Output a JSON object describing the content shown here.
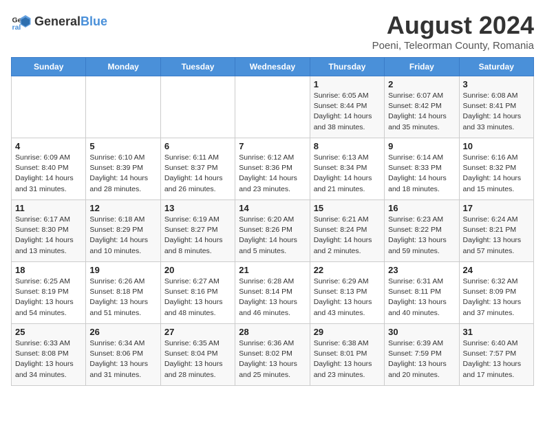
{
  "header": {
    "logo_general": "General",
    "logo_blue": "Blue",
    "title": "August 2024",
    "subtitle": "Poeni, Teleorman County, Romania"
  },
  "weekdays": [
    "Sunday",
    "Monday",
    "Tuesday",
    "Wednesday",
    "Thursday",
    "Friday",
    "Saturday"
  ],
  "weeks": [
    [
      {
        "day": "",
        "info": ""
      },
      {
        "day": "",
        "info": ""
      },
      {
        "day": "",
        "info": ""
      },
      {
        "day": "",
        "info": ""
      },
      {
        "day": "1",
        "info": "Sunrise: 6:05 AM\nSunset: 8:44 PM\nDaylight: 14 hours\nand 38 minutes."
      },
      {
        "day": "2",
        "info": "Sunrise: 6:07 AM\nSunset: 8:42 PM\nDaylight: 14 hours\nand 35 minutes."
      },
      {
        "day": "3",
        "info": "Sunrise: 6:08 AM\nSunset: 8:41 PM\nDaylight: 14 hours\nand 33 minutes."
      }
    ],
    [
      {
        "day": "4",
        "info": "Sunrise: 6:09 AM\nSunset: 8:40 PM\nDaylight: 14 hours\nand 31 minutes."
      },
      {
        "day": "5",
        "info": "Sunrise: 6:10 AM\nSunset: 8:39 PM\nDaylight: 14 hours\nand 28 minutes."
      },
      {
        "day": "6",
        "info": "Sunrise: 6:11 AM\nSunset: 8:37 PM\nDaylight: 14 hours\nand 26 minutes."
      },
      {
        "day": "7",
        "info": "Sunrise: 6:12 AM\nSunset: 8:36 PM\nDaylight: 14 hours\nand 23 minutes."
      },
      {
        "day": "8",
        "info": "Sunrise: 6:13 AM\nSunset: 8:34 PM\nDaylight: 14 hours\nand 21 minutes."
      },
      {
        "day": "9",
        "info": "Sunrise: 6:14 AM\nSunset: 8:33 PM\nDaylight: 14 hours\nand 18 minutes."
      },
      {
        "day": "10",
        "info": "Sunrise: 6:16 AM\nSunset: 8:32 PM\nDaylight: 14 hours\nand 15 minutes."
      }
    ],
    [
      {
        "day": "11",
        "info": "Sunrise: 6:17 AM\nSunset: 8:30 PM\nDaylight: 14 hours\nand 13 minutes."
      },
      {
        "day": "12",
        "info": "Sunrise: 6:18 AM\nSunset: 8:29 PM\nDaylight: 14 hours\nand 10 minutes."
      },
      {
        "day": "13",
        "info": "Sunrise: 6:19 AM\nSunset: 8:27 PM\nDaylight: 14 hours\nand 8 minutes."
      },
      {
        "day": "14",
        "info": "Sunrise: 6:20 AM\nSunset: 8:26 PM\nDaylight: 14 hours\nand 5 minutes."
      },
      {
        "day": "15",
        "info": "Sunrise: 6:21 AM\nSunset: 8:24 PM\nDaylight: 14 hours\nand 2 minutes."
      },
      {
        "day": "16",
        "info": "Sunrise: 6:23 AM\nSunset: 8:22 PM\nDaylight: 13 hours\nand 59 minutes."
      },
      {
        "day": "17",
        "info": "Sunrise: 6:24 AM\nSunset: 8:21 PM\nDaylight: 13 hours\nand 57 minutes."
      }
    ],
    [
      {
        "day": "18",
        "info": "Sunrise: 6:25 AM\nSunset: 8:19 PM\nDaylight: 13 hours\nand 54 minutes."
      },
      {
        "day": "19",
        "info": "Sunrise: 6:26 AM\nSunset: 8:18 PM\nDaylight: 13 hours\nand 51 minutes."
      },
      {
        "day": "20",
        "info": "Sunrise: 6:27 AM\nSunset: 8:16 PM\nDaylight: 13 hours\nand 48 minutes."
      },
      {
        "day": "21",
        "info": "Sunrise: 6:28 AM\nSunset: 8:14 PM\nDaylight: 13 hours\nand 46 minutes."
      },
      {
        "day": "22",
        "info": "Sunrise: 6:29 AM\nSunset: 8:13 PM\nDaylight: 13 hours\nand 43 minutes."
      },
      {
        "day": "23",
        "info": "Sunrise: 6:31 AM\nSunset: 8:11 PM\nDaylight: 13 hours\nand 40 minutes."
      },
      {
        "day": "24",
        "info": "Sunrise: 6:32 AM\nSunset: 8:09 PM\nDaylight: 13 hours\nand 37 minutes."
      }
    ],
    [
      {
        "day": "25",
        "info": "Sunrise: 6:33 AM\nSunset: 8:08 PM\nDaylight: 13 hours\nand 34 minutes."
      },
      {
        "day": "26",
        "info": "Sunrise: 6:34 AM\nSunset: 8:06 PM\nDaylight: 13 hours\nand 31 minutes."
      },
      {
        "day": "27",
        "info": "Sunrise: 6:35 AM\nSunset: 8:04 PM\nDaylight: 13 hours\nand 28 minutes."
      },
      {
        "day": "28",
        "info": "Sunrise: 6:36 AM\nSunset: 8:02 PM\nDaylight: 13 hours\nand 25 minutes."
      },
      {
        "day": "29",
        "info": "Sunrise: 6:38 AM\nSunset: 8:01 PM\nDaylight: 13 hours\nand 23 minutes."
      },
      {
        "day": "30",
        "info": "Sunrise: 6:39 AM\nSunset: 7:59 PM\nDaylight: 13 hours\nand 20 minutes."
      },
      {
        "day": "31",
        "info": "Sunrise: 6:40 AM\nSunset: 7:57 PM\nDaylight: 13 hours\nand 17 minutes."
      }
    ]
  ]
}
